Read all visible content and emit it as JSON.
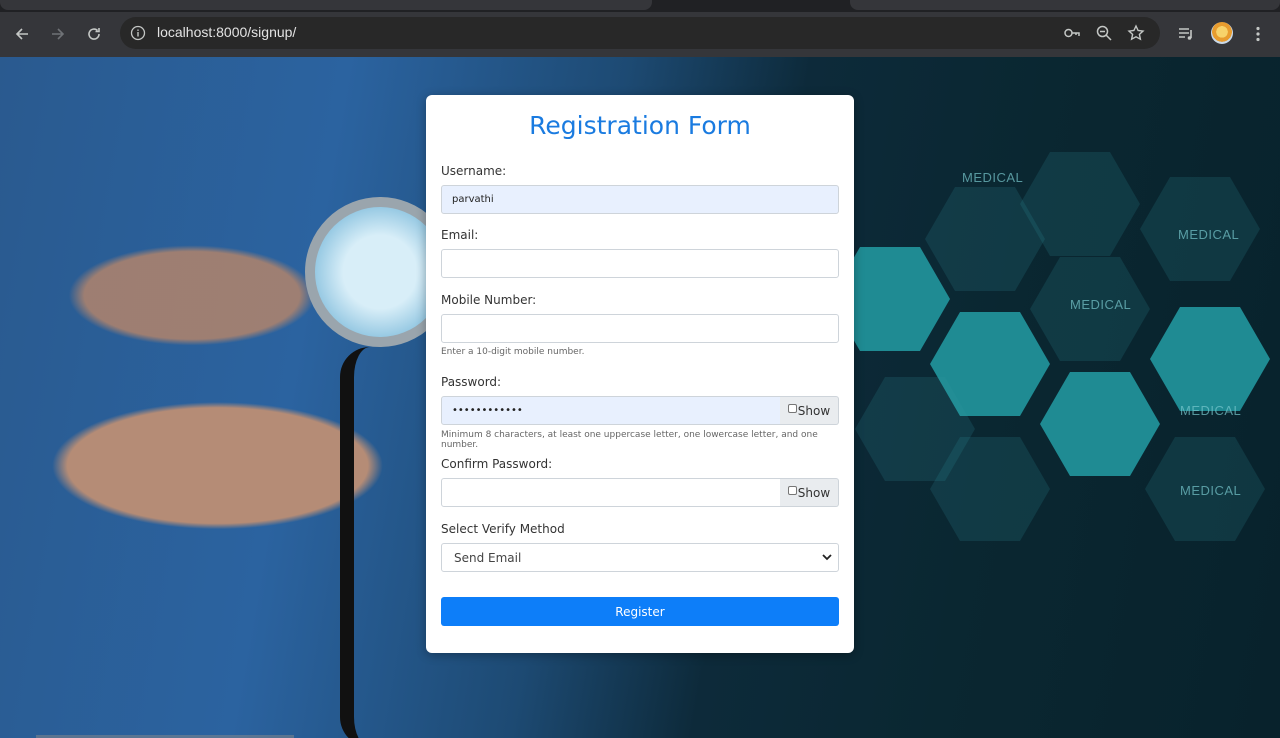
{
  "browser": {
    "url": "localhost:8000/signup/",
    "icons": {
      "back": "arrow-left-icon",
      "forward": "arrow-right-icon",
      "reload": "reload-icon",
      "site_info": "info-icon",
      "password_manager": "key-icon",
      "zoom": "zoom-icon",
      "bookmark": "star-icon",
      "media": "media-queue-icon",
      "menu": "kebab-menu-icon"
    }
  },
  "background": {
    "labels": [
      "MEDICAL",
      "MEDICAL",
      "MEDICAL",
      "MEDICAL",
      "MEDICAL"
    ]
  },
  "form": {
    "title": "Registration Form",
    "username": {
      "label": "Username:",
      "value": "parvathi"
    },
    "email": {
      "label": "Email:",
      "value": ""
    },
    "mobile": {
      "label": "Mobile Number:",
      "value": "",
      "hint": "Enter a 10-digit mobile number."
    },
    "password": {
      "label": "Password:",
      "value": "••••••••••••",
      "show_label": "Show",
      "hint": "Minimum 8 characters, at least one uppercase letter, one lowercase letter, and one number."
    },
    "confirm_password": {
      "label": "Confirm Password:",
      "value": "",
      "show_label": "Show"
    },
    "verify_method": {
      "label": "Select Verify Method",
      "selected": "Send Email"
    },
    "submit_label": "Register"
  },
  "colors": {
    "title": "#1a7be0",
    "button": "#0d7ef9",
    "autofill": "#e8f0fe"
  }
}
